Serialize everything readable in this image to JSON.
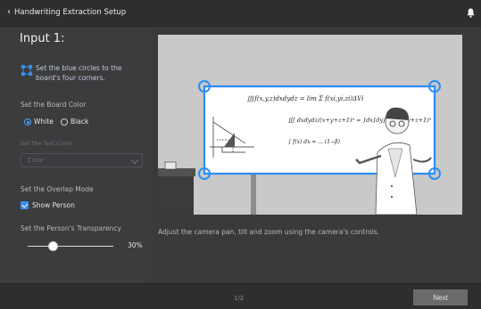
{
  "header": {
    "title": "Handwriting Extraction Setup"
  },
  "panel": {
    "heading": "Input 1:",
    "instruction": "Set the blue circles to the board's four corners.",
    "board_color": {
      "label": "Set the Board Color",
      "options": [
        "White",
        "Black"
      ],
      "selected": "White"
    },
    "text_color": {
      "label": "Set the Text Color",
      "value": "Color",
      "disabled": true
    },
    "overlap": {
      "label": "Set the Overlap Mode",
      "checkbox_label": "Show Person",
      "checked": true
    },
    "transparency": {
      "label": "Set the Person's Transparency",
      "value_text": "30%",
      "value_fraction": 0.3
    }
  },
  "preview": {
    "caption": "Adjust the camera pan, tilt and zoom using the camera's controls."
  },
  "footer": {
    "page": "1/2",
    "next_label": "Next"
  },
  "colors": {
    "accent": "#3a8ee6",
    "background": "#3a3a3d",
    "bar": "#2e2e31",
    "handle": "#2f8df5"
  },
  "icons": [
    "chevron-left-icon",
    "bell-icon",
    "corner-handles-icon",
    "chevron-down-icon"
  ]
}
